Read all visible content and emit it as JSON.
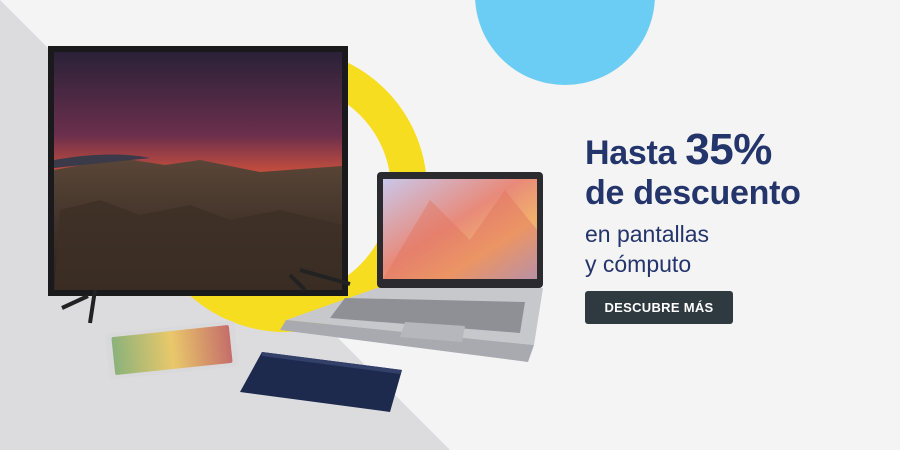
{
  "banner": {
    "headline_prefix": "Hasta ",
    "headline_percent": "35%",
    "headline_line2": "de descuento",
    "sub_line1": "en pantallas",
    "sub_line2": "y cómputo",
    "cta_label": "DESCUBRE MÁS"
  },
  "colors": {
    "background": "#f4f4f5",
    "gray_diagonal": "#dcdcde",
    "yellow_arc": "#f7dd1f",
    "blue_circle": "#6bcdf3",
    "headline": "#24356b",
    "cta_background": "#2f3a40",
    "cta_text": "#ffffff"
  },
  "products": {
    "tv": "smart-tv",
    "laptop": "hp-laptop",
    "tablet_small": "tablet-landscape",
    "tablet_flat": "tablet-flat"
  }
}
